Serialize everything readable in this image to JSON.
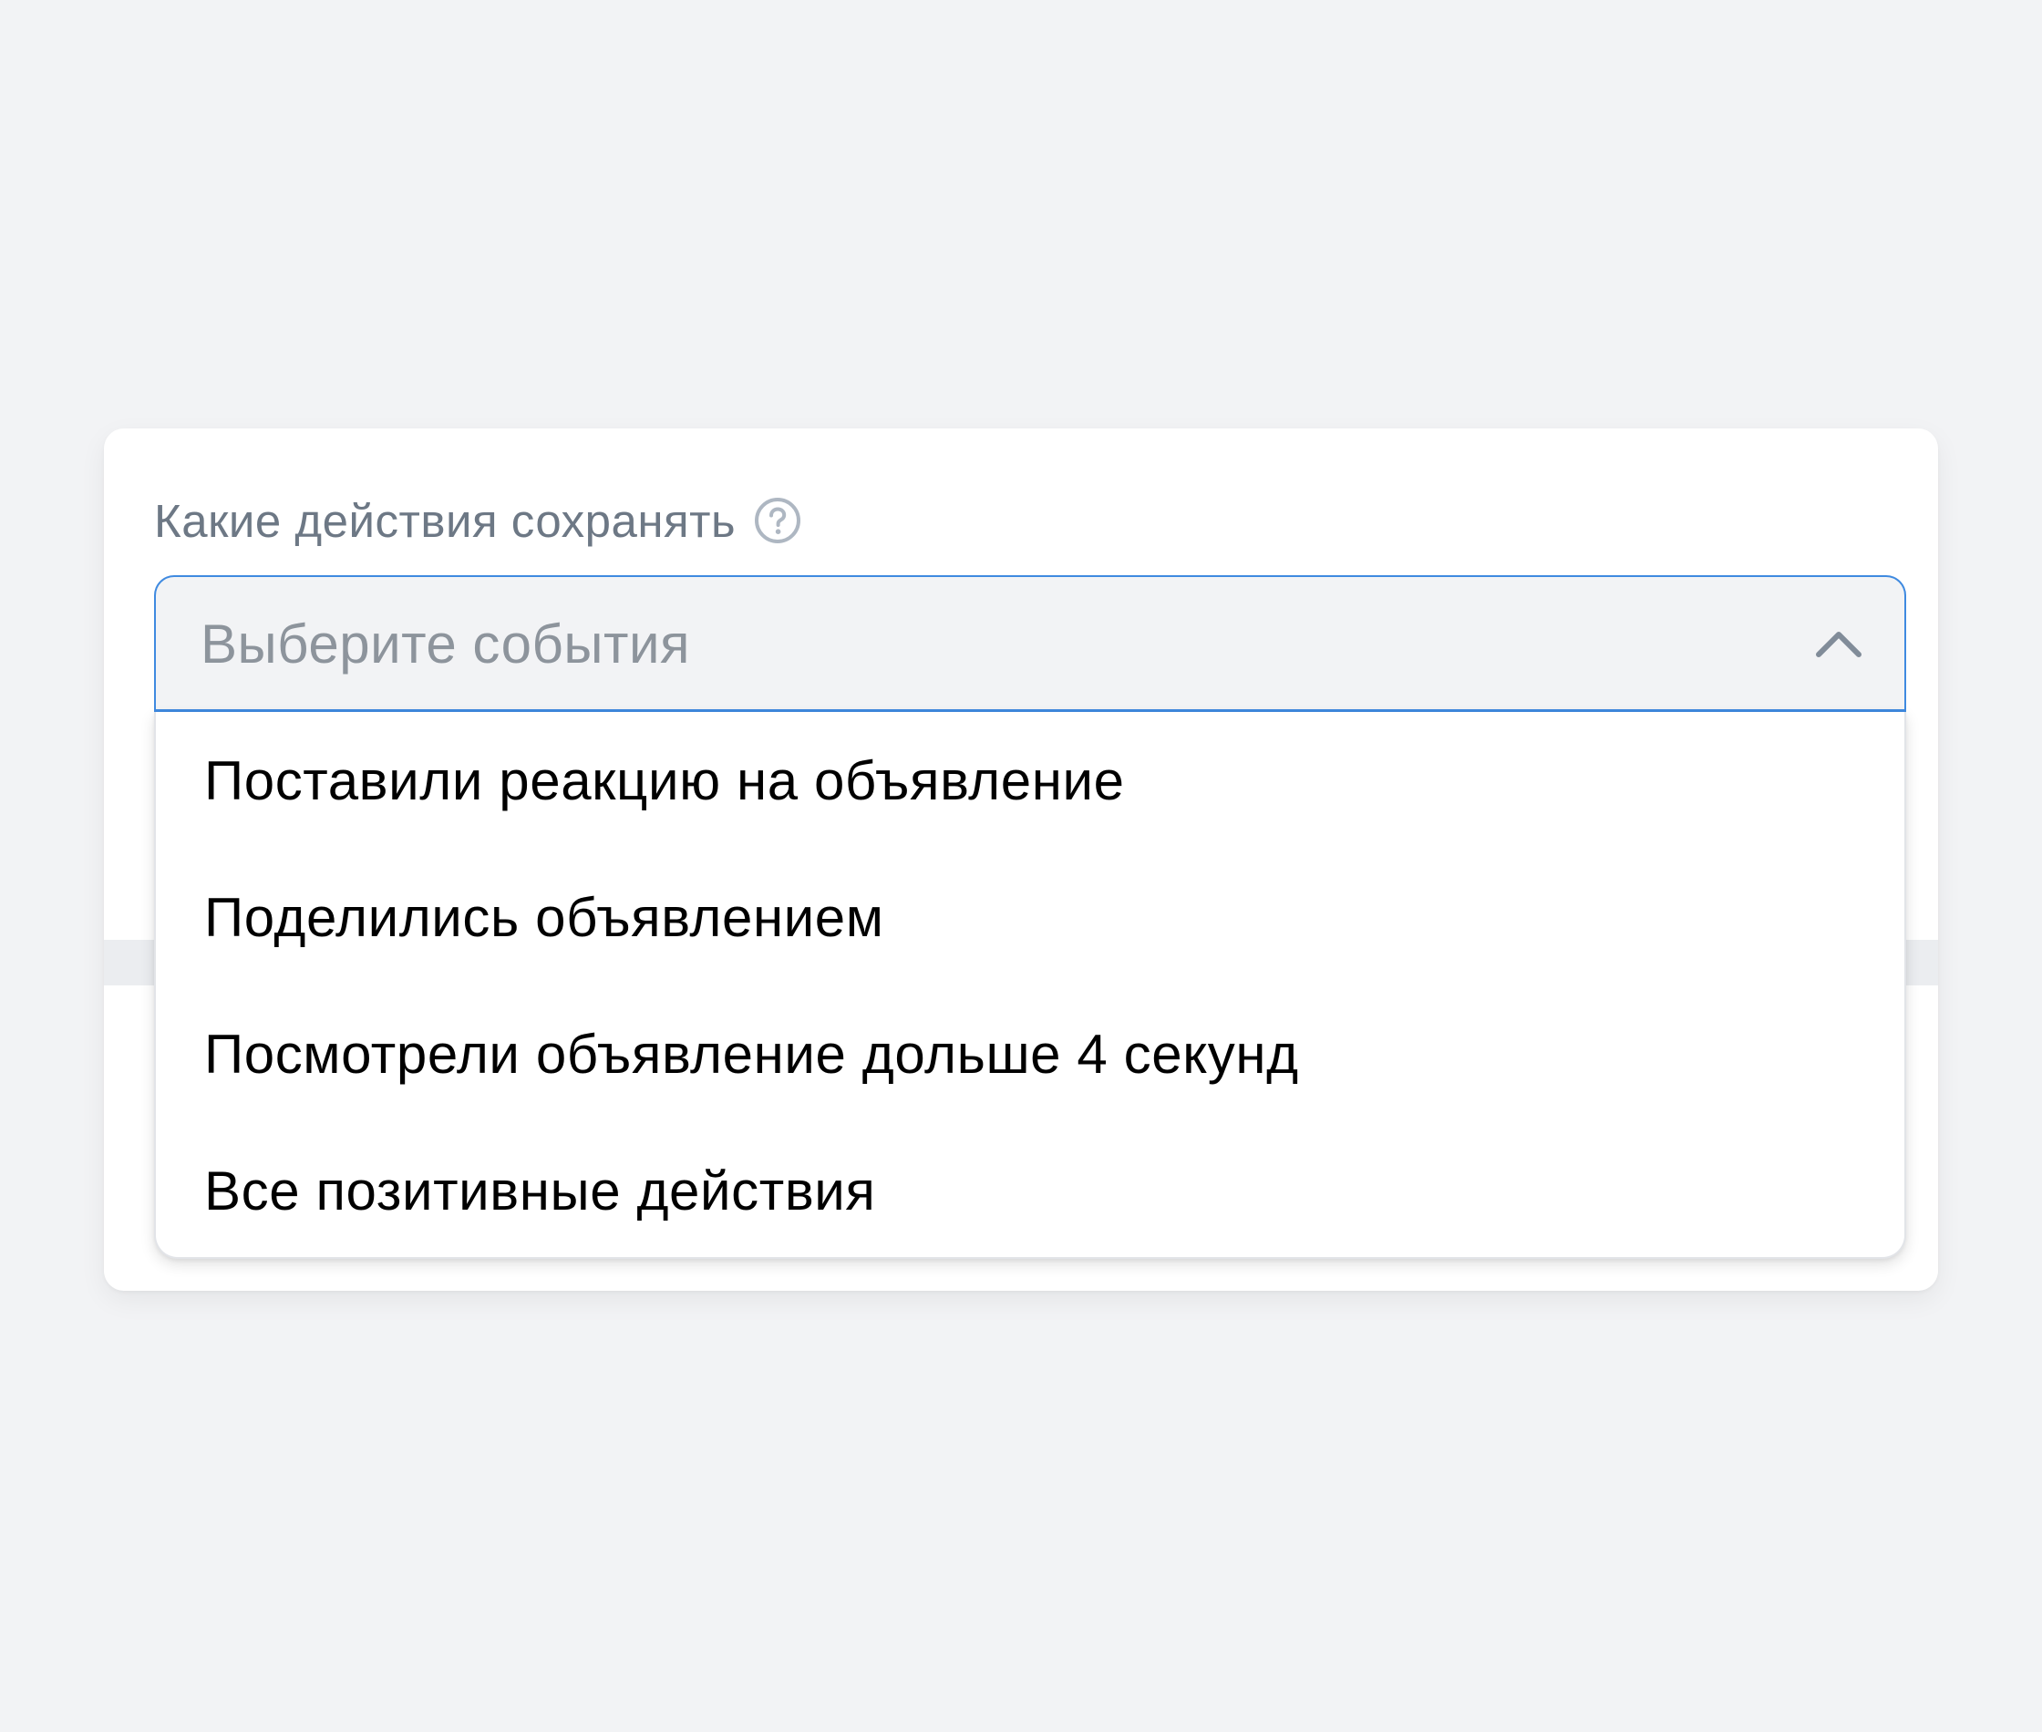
{
  "form": {
    "label": "Какие действия сохранять",
    "help_icon": "question-circle-icon",
    "select": {
      "placeholder": "Выберите события",
      "state": "open",
      "chevron_icon": "chevron-up-icon",
      "accent_color": "#3f8ae0"
    },
    "options": [
      {
        "label": "Поставили реакцию на объявление"
      },
      {
        "label": "Поделились объявлением"
      },
      {
        "label": "Посмотрели объявление дольше 4 секунд"
      },
      {
        "label": "Все позитивные действия"
      }
    ]
  },
  "colors": {
    "background": "#f2f3f5",
    "card": "#ffffff",
    "label_text": "#6d7885",
    "placeholder_text": "#8d949c",
    "option_text": "#000000"
  }
}
